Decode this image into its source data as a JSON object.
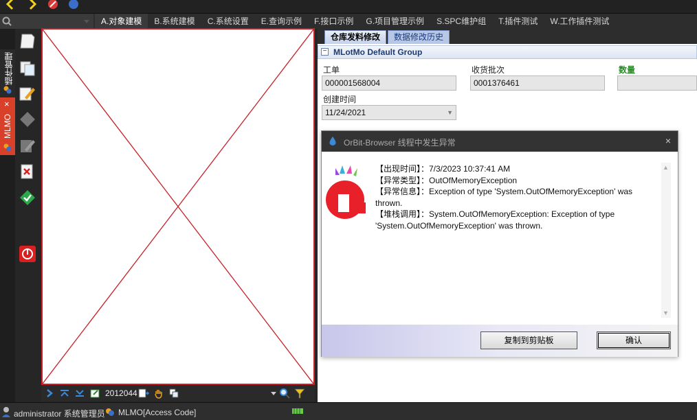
{
  "menu": {
    "items": [
      {
        "label": "A.对象建模",
        "active": true
      },
      {
        "label": "B.系统建模",
        "active": false
      },
      {
        "label": "C.系统设置",
        "active": false
      },
      {
        "label": "E.查询示例",
        "active": false
      },
      {
        "label": "F.接口示例",
        "active": false
      },
      {
        "label": "G.项目管理示例",
        "active": false
      },
      {
        "label": "S.SPC维护组",
        "active": false
      },
      {
        "label": "T.插件测试",
        "active": false
      },
      {
        "label": "W.工作插件测试",
        "active": false
      }
    ]
  },
  "left_tabs": {
    "plugin_label": "插件管理",
    "mlmo_label": "MLMO",
    "mlmo_close": "×"
  },
  "image_toolbar": {
    "record_id": "2012044"
  },
  "form": {
    "tabs": [
      {
        "label": "仓库发料修改",
        "active": true
      },
      {
        "label": "数据修改历史",
        "active": false
      }
    ],
    "group_title": "MLotMo Default Group",
    "fields": {
      "work_order_label": "工单",
      "work_order_value": "000001568004",
      "receive_batch_label": "收货批次",
      "receive_batch_value": "0001376461",
      "quantity_label": "数量",
      "quantity_value": "",
      "created_time_label": "创建时间",
      "created_time_value": "11/24/2021"
    }
  },
  "dialog": {
    "title": "OrBit-Browser 线程中发生异常",
    "close_glyph": "×",
    "lines": [
      "【出现时间】：7/3/2023 10:37:41 AM",
      "【异常类型】：OutOfMemoryException",
      "【异常信息】：Exception of type 'System.OutOfMemoryException' was thrown.",
      "【堆栈调用】：System.OutOfMemoryException: Exception of type 'System.OutOfMemoryException' was thrown."
    ],
    "copy_button": "复制到剪贴板",
    "ok_button": "确认"
  },
  "status": {
    "user": "administrator 系统管理员",
    "module": "MLMO[Access Code]"
  },
  "colors": {
    "accent_red": "#c8202a",
    "mlmo_tab": "#d8402a",
    "group_title": "#1f3a70",
    "quantity_label": "#2a8a2a"
  }
}
